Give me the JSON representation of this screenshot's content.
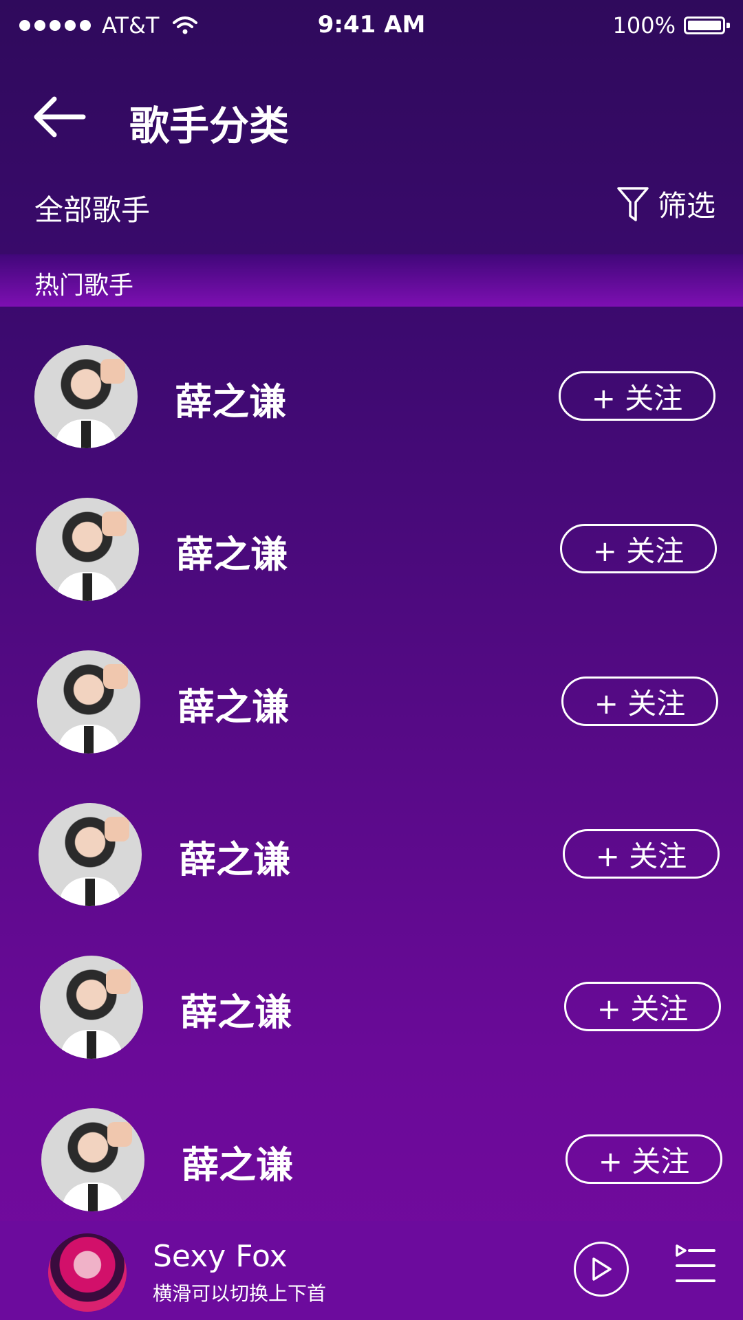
{
  "status_bar": {
    "carrier": "AT&T",
    "time": "9:41 AM",
    "battery_pct": "100%",
    "battery_level": 1.0
  },
  "header": {
    "title": "歌手分类",
    "back_icon": "arrow-left-icon"
  },
  "subheader": {
    "all_label": "全部歌手",
    "filter_label": "筛选",
    "filter_icon": "filter-icon"
  },
  "section": {
    "hot_label": "热门歌手"
  },
  "singers": [
    {
      "name": "薛之谦",
      "follow_label": "+ 关注"
    },
    {
      "name": "薛之谦",
      "follow_label": "+ 关注"
    },
    {
      "name": "薛之谦",
      "follow_label": "+ 关注"
    },
    {
      "name": "薛之谦",
      "follow_label": "+ 关注"
    },
    {
      "name": "薛之谦",
      "follow_label": "+ 关注"
    },
    {
      "name": "薛之谦",
      "follow_label": "+ 关注"
    }
  ],
  "player": {
    "song_title": "Sexy Fox",
    "hint": "横滑可以切换上下首",
    "play_icon": "play-icon",
    "playlist_icon": "playlist-icon"
  }
}
